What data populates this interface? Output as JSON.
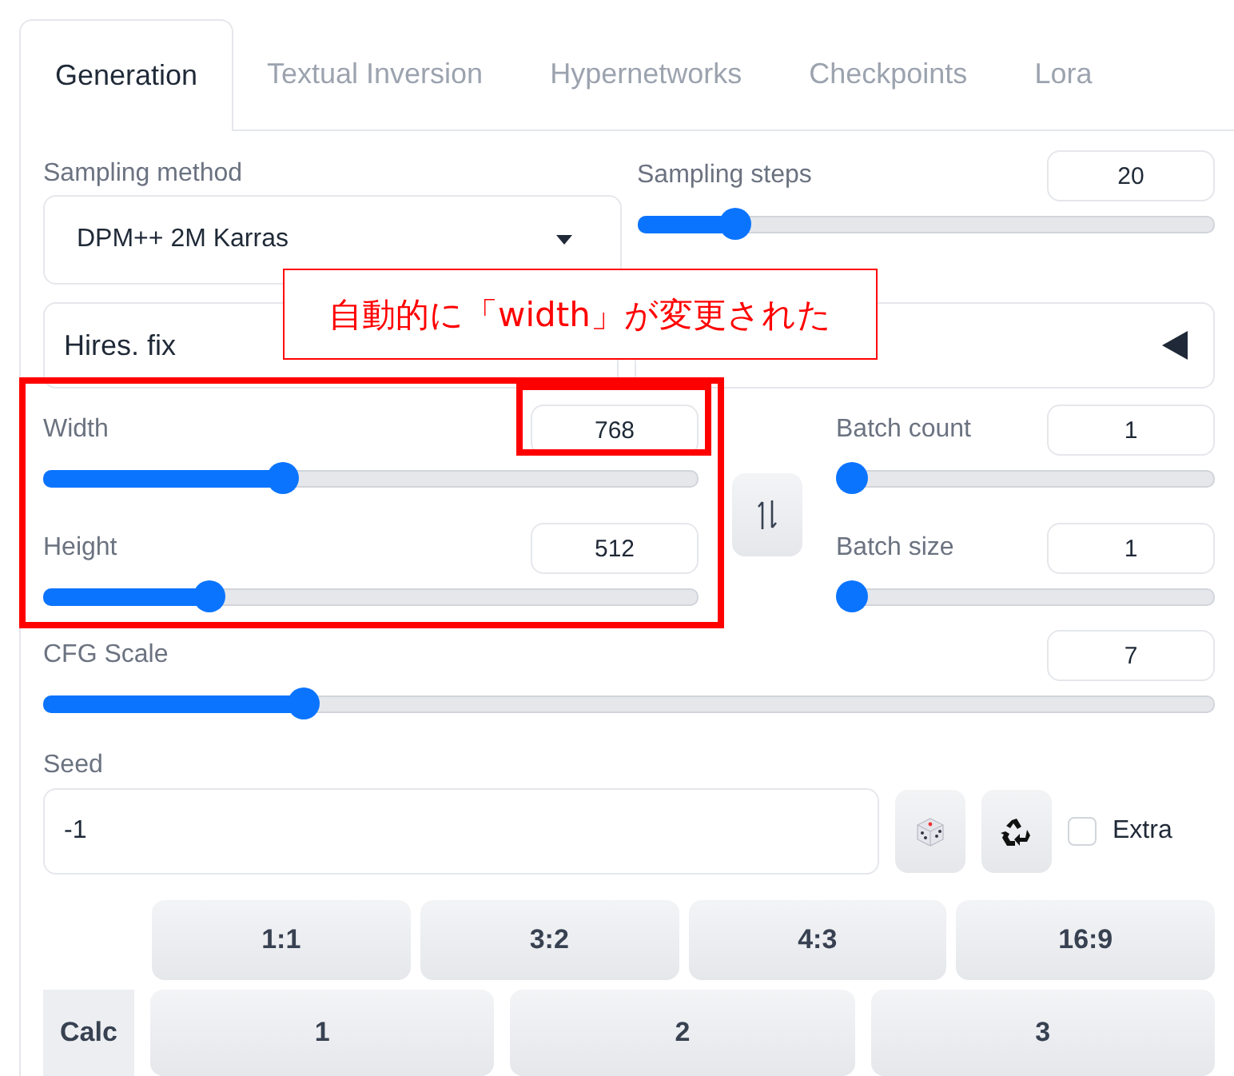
{
  "tabs": [
    {
      "label": "Generation",
      "selected": true
    },
    {
      "label": "Textual Inversion",
      "selected": false
    },
    {
      "label": "Hypernetworks",
      "selected": false
    },
    {
      "label": "Checkpoints",
      "selected": false
    },
    {
      "label": "Lora",
      "selected": false
    }
  ],
  "sampling_method": {
    "label": "Sampling method",
    "value": "DPM++ 2M Karras"
  },
  "sampling_steps": {
    "label": "Sampling steps",
    "value": "20",
    "level": 0.15
  },
  "hires_fix": {
    "label": "Hires. fix"
  },
  "width": {
    "label": "Width",
    "value": "768",
    "level": 0.36
  },
  "height": {
    "label": "Height",
    "value": "512",
    "level": 0.24
  },
  "batch_count": {
    "label": "Batch count",
    "value": "1",
    "level": 0
  },
  "batch_size": {
    "label": "Batch size",
    "value": "1",
    "level": 0
  },
  "cfg_scale": {
    "label": "CFG Scale",
    "value": "7",
    "level": 0.214
  },
  "seed": {
    "label": "Seed",
    "value": "-1",
    "extra": {
      "label": "Extra",
      "checked": false
    }
  },
  "ratio_buttons": [
    "1:1",
    "3:2",
    "4:3",
    "16:9"
  ],
  "calc": {
    "label": "Calc",
    "buttons": [
      "1",
      "2",
      "3"
    ]
  },
  "annotation": {
    "text": "自動的に「width」が変更された"
  }
}
